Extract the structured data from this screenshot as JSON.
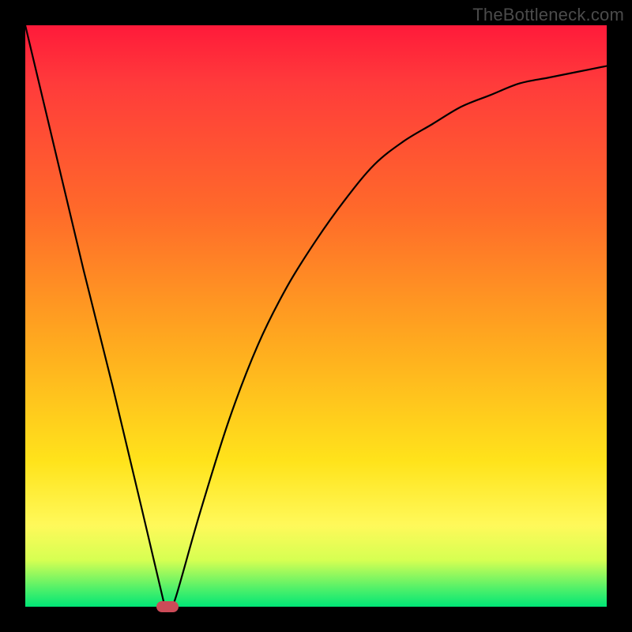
{
  "watermark": "TheBottleneck.com",
  "colors": {
    "frame": "#000000",
    "gradient_top": "#ff1a3a",
    "gradient_mid1": "#ff6a2a",
    "gradient_mid2": "#ffe31b",
    "gradient_bottom": "#00e676",
    "curve_stroke": "#000000",
    "marker": "#cc4b58"
  },
  "chart_data": {
    "type": "line",
    "title": "",
    "xlabel": "",
    "ylabel": "",
    "xlim": [
      0,
      100
    ],
    "ylim": [
      0,
      100
    ],
    "series": [
      {
        "name": "bottleneck-curve",
        "x": [
          0,
          5,
          10,
          15,
          20,
          24,
          25,
          26,
          30,
          35,
          40,
          45,
          50,
          55,
          60,
          65,
          70,
          75,
          80,
          85,
          90,
          95,
          100
        ],
        "values": [
          100,
          79,
          58,
          38,
          17,
          0,
          0,
          2,
          16,
          32,
          45,
          55,
          63,
          70,
          76,
          80,
          83,
          86,
          88,
          90,
          91,
          92,
          93
        ]
      }
    ],
    "marker": {
      "x": 24.5,
      "y": 0,
      "width_pct": 3.8,
      "height_pct": 1.8
    }
  }
}
